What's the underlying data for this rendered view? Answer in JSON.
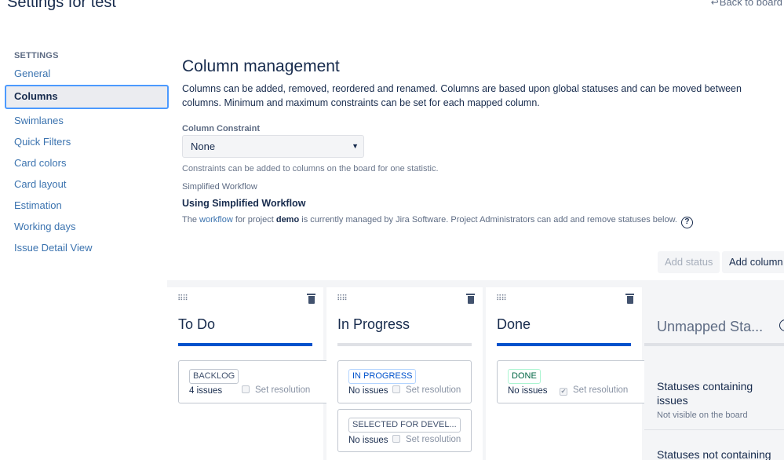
{
  "page": {
    "title": "Settings for test",
    "back_link": "Back to board"
  },
  "sidebar": {
    "heading": "SETTINGS",
    "items": [
      {
        "label": "General"
      },
      {
        "label": "Columns"
      },
      {
        "label": "Swimlanes"
      },
      {
        "label": "Quick Filters"
      },
      {
        "label": "Card colors"
      },
      {
        "label": "Card layout"
      },
      {
        "label": "Estimation"
      },
      {
        "label": "Working days"
      },
      {
        "label": "Issue Detail View"
      }
    ],
    "active_item": "Columns"
  },
  "main": {
    "heading": "Column management",
    "intro": "Columns can be added, removed, reordered and renamed. Columns are based upon global statuses and can be moved between columns. Minimum and maximum constraints can be set for each mapped column.",
    "constraint": {
      "label": "Column Constraint",
      "value": "None",
      "help": "Constraints can be added to columns on the board for one statistic."
    },
    "workflow": {
      "label": "Simplified Workflow",
      "title": "Using Simplified Workflow",
      "desc_pre": "The ",
      "desc_link": "workflow",
      "desc_mid": " for project ",
      "desc_project": "demo",
      "desc_post": " is currently managed by Jira Software. Project Administrators can add and remove statuses below.",
      "help_glyph": "?"
    },
    "buttons": {
      "add_status": "Add status",
      "add_column": "Add column"
    }
  },
  "columns": [
    {
      "name": "To Do",
      "cards": [
        {
          "status": "BACKLOG",
          "count": "4 issues",
          "resolution": "Set resolution",
          "checked": false
        }
      ]
    },
    {
      "name": "In Progress",
      "cards": [
        {
          "status": "IN PROGRESS",
          "count": "No issues",
          "resolution": "Set resolution",
          "checked": false
        },
        {
          "status": "SELECTED FOR DEVEL...",
          "count": "No issues",
          "resolution": "Set resolution",
          "checked": false
        }
      ]
    },
    {
      "name": "Done",
      "cards": [
        {
          "status": "DONE",
          "count": "No issues",
          "resolution": "Set resolution",
          "checked": true
        }
      ]
    }
  ],
  "unmapped": {
    "title": "Unmapped Sta...",
    "section1_title": "Statuses containing issues",
    "section1_sub": "Not visible on the board",
    "section2_title": "Statuses not containing"
  },
  "colors": {
    "accent": "#0052cc",
    "link": "#3b73af",
    "board_bg": "#f4f5f7"
  },
  "icons": {
    "grip": "drag-handle-icon",
    "trash": "trash-icon",
    "help": "help-icon",
    "back": "back-arrow-icon"
  }
}
